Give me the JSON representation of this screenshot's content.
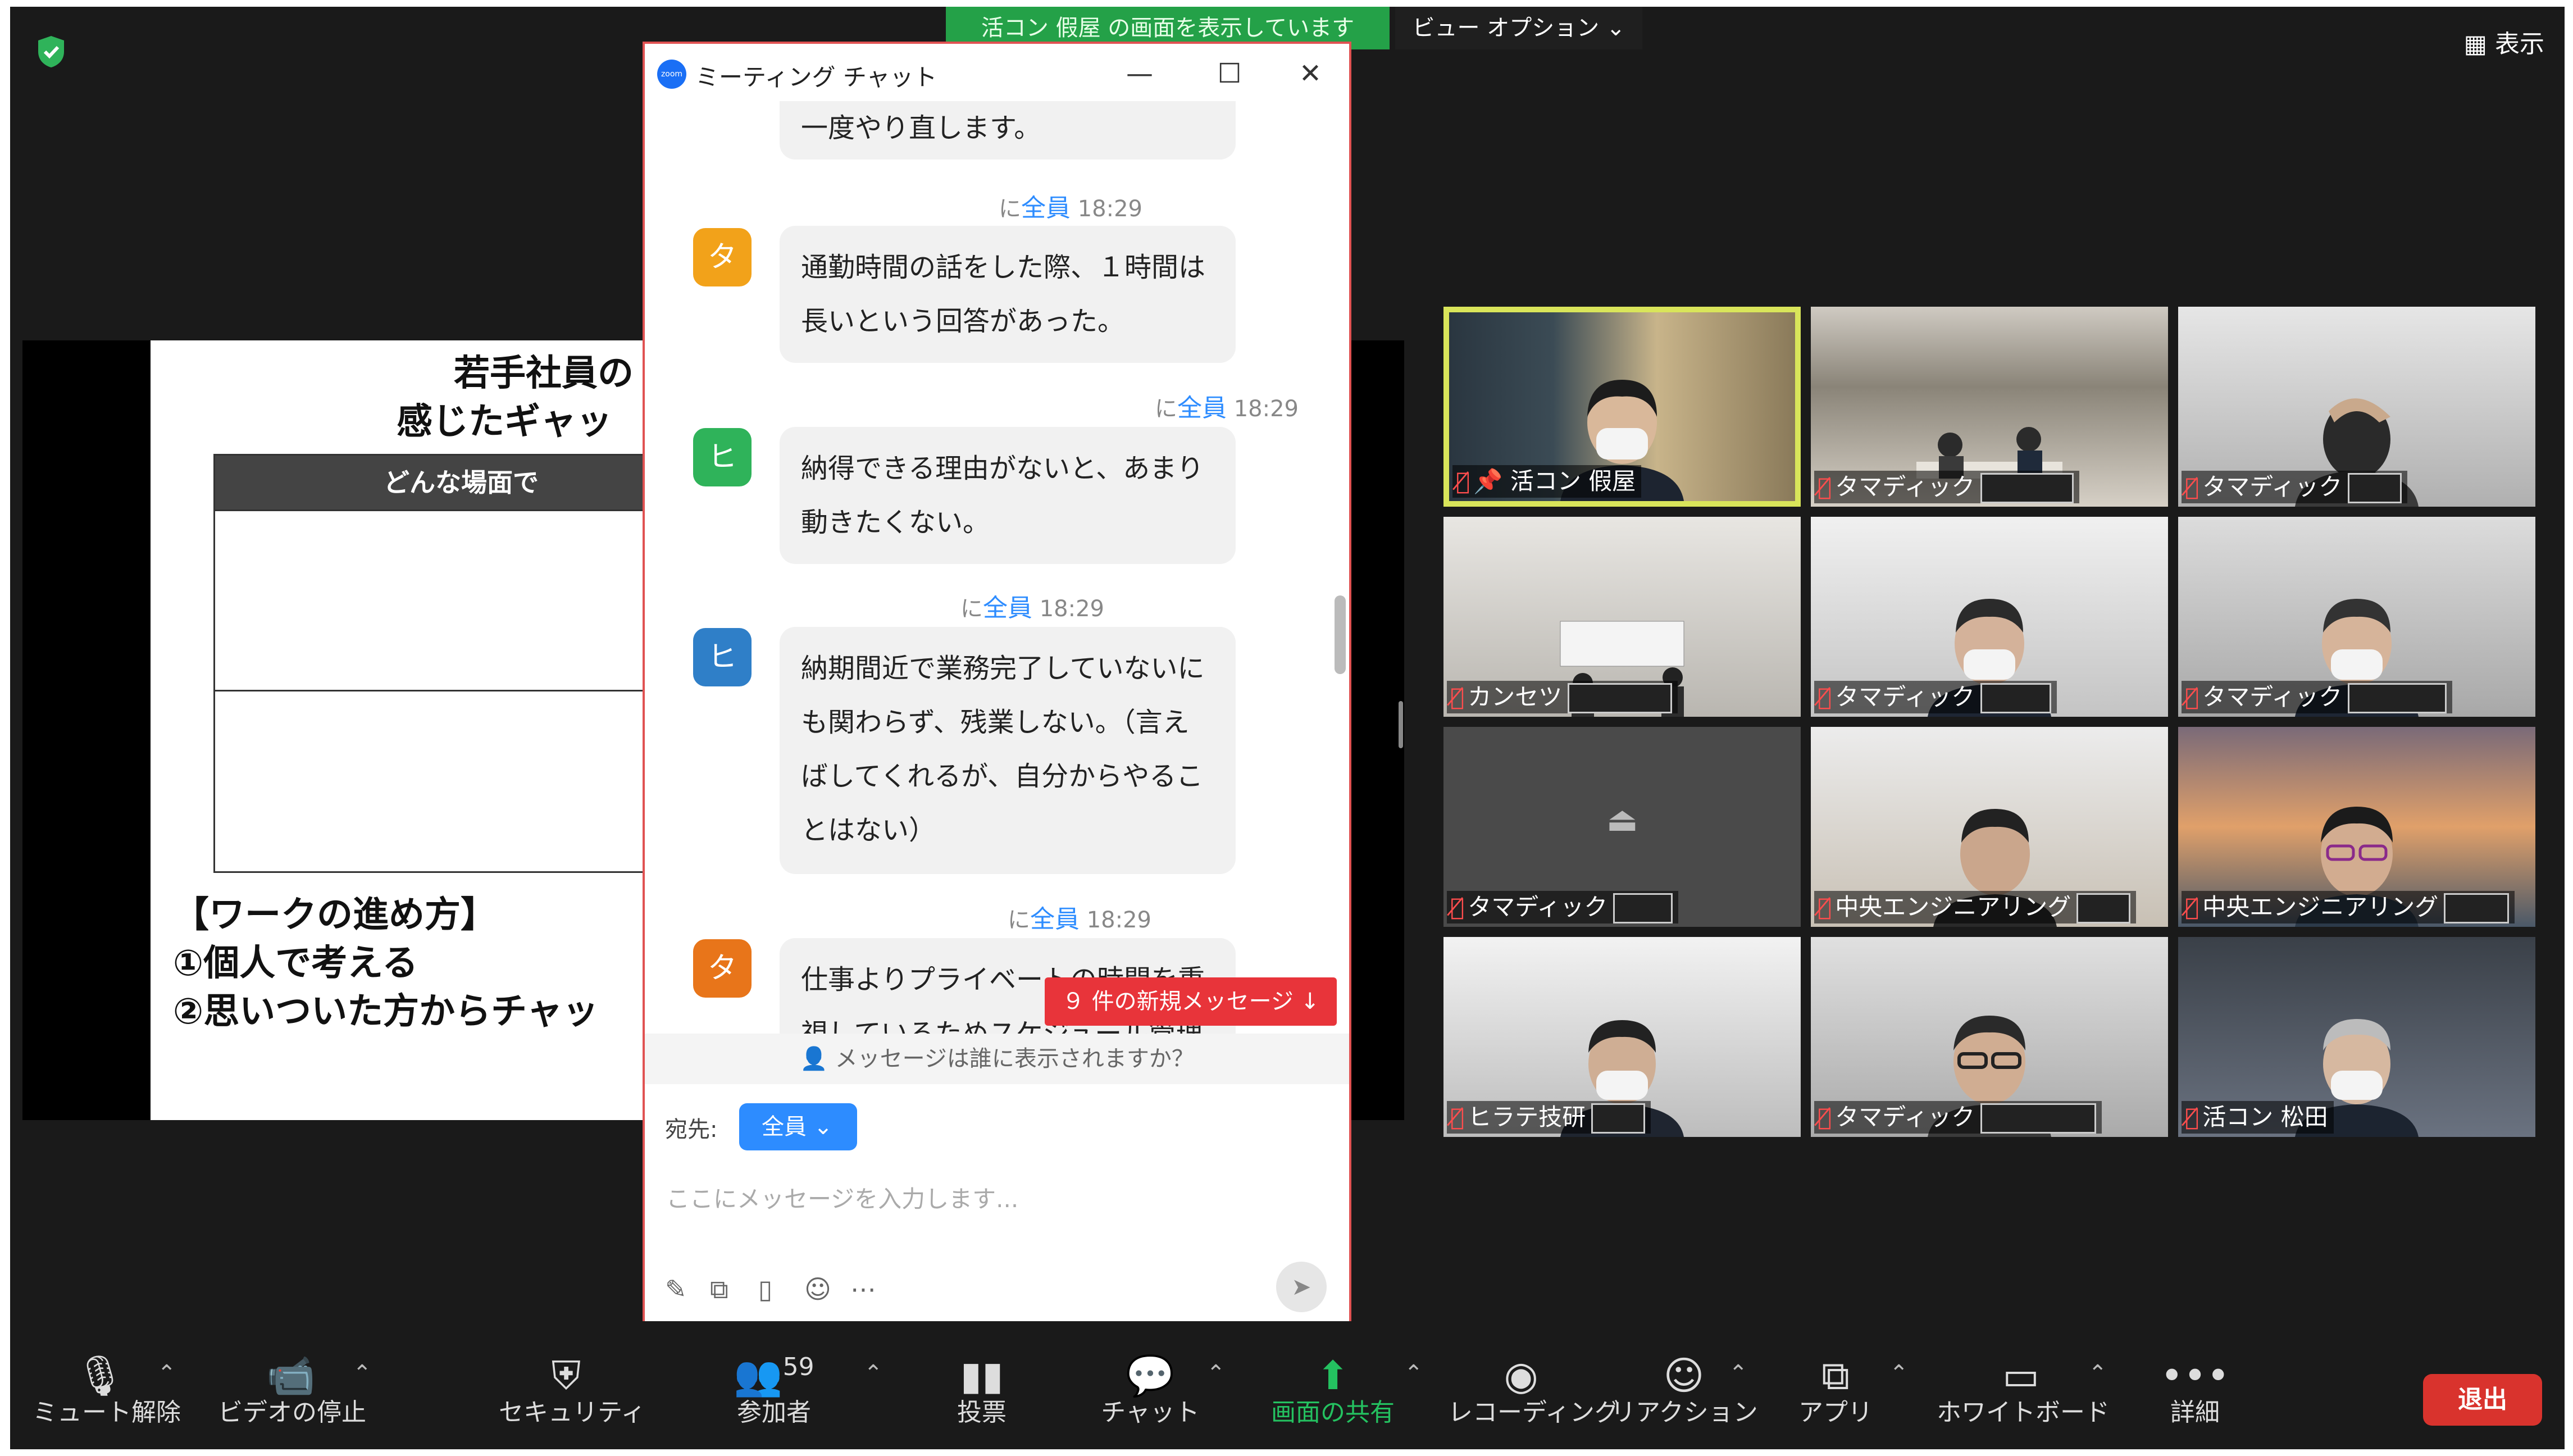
{
  "top": {
    "share_banner": "活コン 假屋 の画面を表示しています",
    "view_options": "ビュー オプション ⌄",
    "display": "表示"
  },
  "slide": {
    "title_line1": "若手社員の",
    "title_line2": "感じたギャッ",
    "table_header": "どんな場面で",
    "steps_heading": "【ワークの進め方】",
    "step1": "①個人で考える",
    "step2": "②思いついた方からチャッ"
  },
  "chat": {
    "window_title": "ミーティング チャット",
    "minimize": "—",
    "maximize": "☐",
    "close": "✕",
    "messages": [
      {
        "text": "一度やり直します。"
      },
      {
        "to_prefix": "に",
        "to": "全員",
        "time": "18:29",
        "avatar": "タ",
        "avatar_color": "#f2a21a",
        "text": "通勤時間の話をした際、１時間は長いという回答があった。"
      },
      {
        "to_prefix": "に",
        "to": "全員",
        "time": "18:29",
        "avatar": "ヒ",
        "avatar_color": "#2fb35a",
        "text": "納得できる理由がないと、あまり動きたくない。"
      },
      {
        "to_prefix": "に",
        "to": "全員",
        "time": "18:29",
        "avatar": "ヒ",
        "avatar_color": "#2f7fc8",
        "text": "納期間近で業務完了していないにも関わらず、残業しない。（言えばしてくれるが、自分からやることはない）"
      },
      {
        "to_prefix": "に",
        "to": "全員",
        "time": "18:29",
        "avatar": "タ",
        "avatar_color": "#e8751a",
        "text": "仕事よりプライベートの時間を重視しているためスケジュール管理が大"
      }
    ],
    "new_messages": "９ 件の新規メッセージ ↓",
    "visibility": "メッセージは誰に表示されますか？",
    "recipient_label": "宛先:",
    "recipient_value": "全員 ⌄",
    "input_placeholder": "ここにメッセージを入力します..."
  },
  "participants": [
    {
      "name": "活コン 假屋",
      "active": true,
      "pinned": true,
      "redacted": false
    },
    {
      "name": "タマディック",
      "active": false,
      "redacted": true
    },
    {
      "name": "タマディック",
      "active": false,
      "redacted": true
    },
    {
      "name": "カンセツ",
      "active": false,
      "redacted": true
    },
    {
      "name": "タマディック",
      "active": false,
      "redacted": true
    },
    {
      "name": "タマディック",
      "active": false,
      "redacted": true
    },
    {
      "name": "タマディック",
      "active": false,
      "redacted": true
    },
    {
      "name": "中央エンジニアリング",
      "active": false,
      "redacted": true
    },
    {
      "name": "中央エンジニアリング",
      "active": false,
      "redacted": true
    },
    {
      "name": "ヒラテ技研",
      "active": false,
      "redacted": true
    },
    {
      "name": "タマディック",
      "active": false,
      "redacted": true
    },
    {
      "name": "活コン 松田",
      "active": false,
      "redacted": false
    }
  ],
  "toolbar": {
    "mute": "ミュート解除",
    "video": "ビデオの停止",
    "security": "セキュリティ",
    "participants": "参加者",
    "participants_count": "59",
    "polls": "投票",
    "chat": "チャット",
    "share": "画面の共有",
    "record": "レコーディング",
    "reactions": "リアクション",
    "apps": "アプリ",
    "whiteboard": "ホワイトボード",
    "more": "詳細",
    "leave": "退出"
  },
  "colors": {
    "share_green": "#24a148",
    "active_speaker": "#d9e55a",
    "leave_red": "#d9332d",
    "accent_blue": "#2d8cff"
  }
}
